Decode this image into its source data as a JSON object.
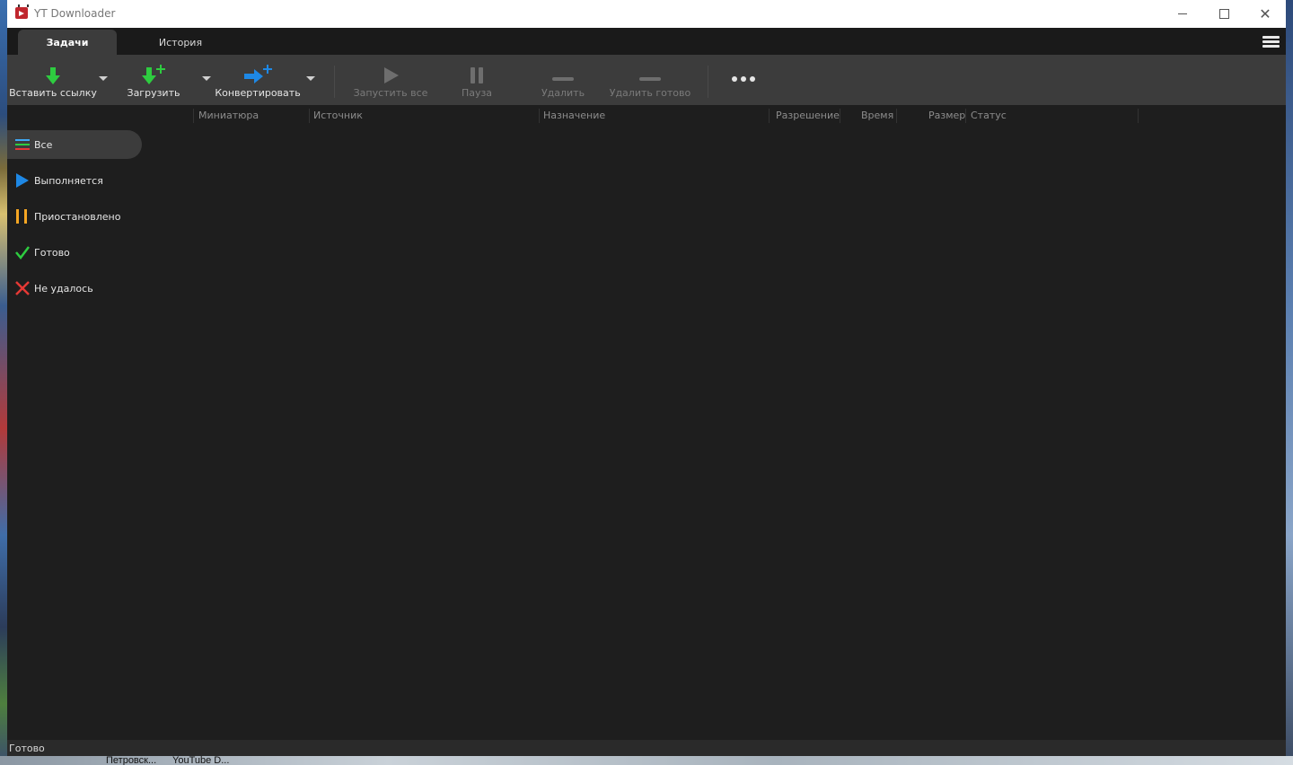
{
  "window": {
    "title": "YT Downloader"
  },
  "tabs": [
    {
      "label": "Задачи",
      "active": true
    },
    {
      "label": "История",
      "active": false
    }
  ],
  "toolbar": {
    "paste_link": "Вставить ссылку",
    "download": "Загрузить",
    "convert": "Конвертировать",
    "start_all": "Запустить все",
    "pause": "Пауза",
    "delete": "Удалить",
    "delete_done": "Удалить готово"
  },
  "columns": [
    "Миниатюра",
    "Источник",
    "Назначение",
    "Разрешение",
    "Время",
    "Размер",
    "Статус"
  ],
  "sidebar": {
    "items": [
      {
        "label": "Все",
        "icon": "list-icon",
        "active": true
      },
      {
        "label": "Выполняется",
        "icon": "play-icon",
        "color": "#1e88e5"
      },
      {
        "label": "Приостановлено",
        "icon": "pause-icon",
        "color": "#f5a623"
      },
      {
        "label": "Готово",
        "icon": "check-icon",
        "color": "#2ecc40"
      },
      {
        "label": "Не удалось",
        "icon": "cross-icon",
        "color": "#e53935"
      }
    ]
  },
  "status": {
    "text": "Готово"
  },
  "taskbar": {
    "items": [
      "Петровск...",
      "YouTube D..."
    ]
  },
  "colors": {
    "accent_green": "#2ecc40",
    "accent_blue": "#1e88e5",
    "window_bg": "#1e1e1e",
    "toolbar_bg": "#3c3c3c"
  }
}
